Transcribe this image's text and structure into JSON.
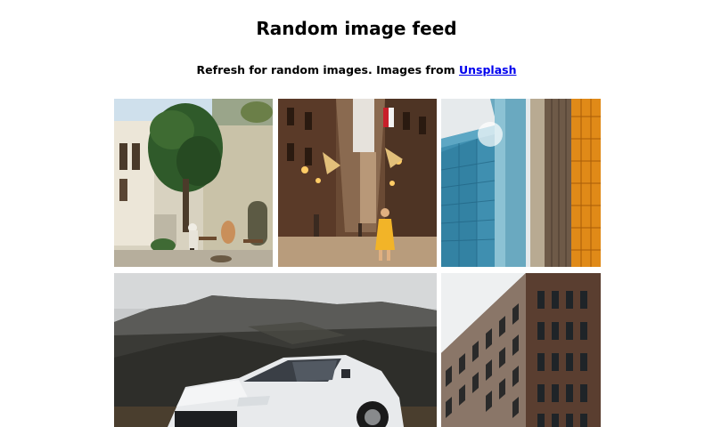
{
  "page": {
    "title": "Random image feed",
    "subtitle_prefix": "Refresh for random images. Images from ",
    "link_text": "Unsplash"
  },
  "images": [
    {
      "subject": "street-tree-scene"
    },
    {
      "subject": "narrow-street-woman-yellow-dress"
    },
    {
      "subject": "glass-skyscrapers"
    },
    {
      "subject": "white-suv-mountain"
    },
    {
      "subject": "brick-building"
    }
  ]
}
